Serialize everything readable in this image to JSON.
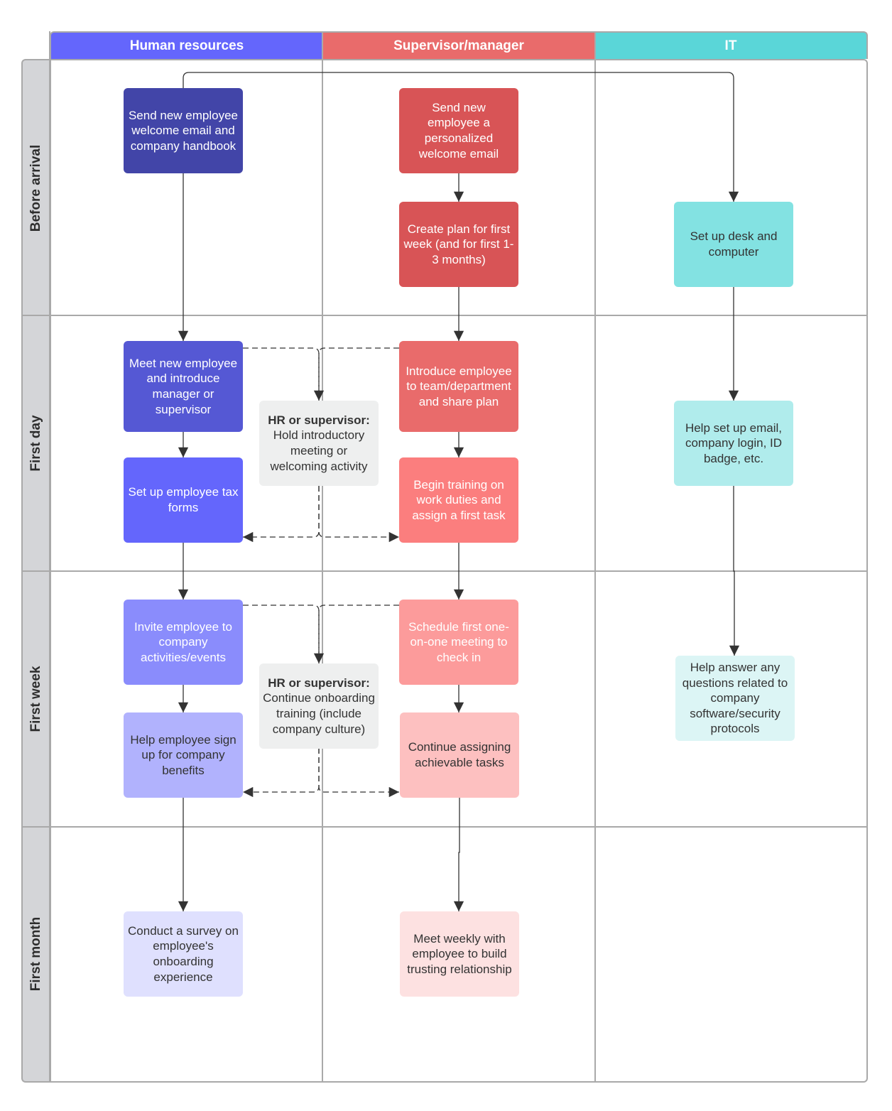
{
  "lanes": [
    {
      "label": "Human resources",
      "color": "#6466fc"
    },
    {
      "label": "Supervisor/manager",
      "color": "#e96b6b"
    },
    {
      "label": "IT",
      "color": "#5ad6d8"
    }
  ],
  "phases": [
    {
      "label": "Before arrival"
    },
    {
      "label": "First day"
    },
    {
      "label": "First week"
    },
    {
      "label": "First month"
    }
  ],
  "nodes": {
    "hr_welcome_email": {
      "text": "Send new employee welcome email and company handbook",
      "fill": "#4245a8",
      "text_color": "#ffffff"
    },
    "hr_meet_introduce": {
      "text": "Meet new employee and introduce manager or supervisor",
      "fill": "#5558d4",
      "text_color": "#ffffff"
    },
    "hr_tax_forms": {
      "text": "Set up employee tax forms",
      "fill": "#6466fc",
      "text_color": "#ffffff"
    },
    "hr_invite_events": {
      "text": "Invite employee to company activities/events",
      "fill": "#8a8cfc",
      "text_color": "#ffffff"
    },
    "hr_benefits": {
      "text": "Help employee sign up for company benefits",
      "fill": "#b1b2fd",
      "text_color": "#333333"
    },
    "hr_survey": {
      "text": "Conduct a survey on employee's onboarding experience",
      "fill": "#dfe0fe",
      "text_color": "#333333"
    },
    "shared_intro_meeting": {
      "bold": "HR or supervisor:",
      "text": "Hold introductory meeting or welcoming activity",
      "fill": "#eeefef",
      "text_color": "#333333"
    },
    "shared_onboarding_training": {
      "bold": "HR or supervisor:",
      "text": "Continue onboarding training (include company culture)",
      "fill": "#eeefef",
      "text_color": "#333333"
    },
    "mgr_personal_email": {
      "text": "Send new employee a personalized welcome email",
      "fill": "#d85456",
      "text_color": "#ffffff"
    },
    "mgr_create_plan": {
      "text": "Create plan for first week (and for first 1-3 months)",
      "fill": "#d85456",
      "text_color": "#ffffff"
    },
    "mgr_introduce_team": {
      "text": "Introduce employee to team/department and share plan",
      "fill": "#e96b6b",
      "text_color": "#ffffff"
    },
    "mgr_begin_training": {
      "text": "Begin training on work duties and assign a first task",
      "fill": "#fb7e7e",
      "text_color": "#ffffff"
    },
    "mgr_schedule_1on1": {
      "text": "Schedule first one-on-one meeting to check in",
      "fill": "#fc9b9b",
      "text_color": "#ffffff"
    },
    "mgr_continue_tasks": {
      "text": "Continue assigning achievable tasks",
      "fill": "#fdc0c0",
      "text_color": "#333333"
    },
    "mgr_meet_weekly": {
      "text": "Meet weekly with employee to build trusting relationship",
      "fill": "#fde1e1",
      "text_color": "#333333"
    },
    "it_desk_computer": {
      "text": "Set up desk and computer",
      "fill": "#83e2e2",
      "text_color": "#333333"
    },
    "it_email_login": {
      "text": "Help set up email, company login, ID badge, etc.",
      "fill": "#b0ecec",
      "text_color": "#333333"
    },
    "it_answer_questions": {
      "text": "Help answer any questions related to company software/security protocols",
      "fill": "#dcf5f5",
      "text_color": "#333333"
    }
  },
  "connectors": [
    {
      "from": "hr_welcome_email",
      "to": "hr_meet_introduce",
      "style": "solid"
    },
    {
      "from": "hr_welcome_email",
      "to": "it_desk_computer",
      "style": "solid"
    },
    {
      "from": "mgr_personal_email",
      "to": "mgr_create_plan",
      "style": "solid"
    },
    {
      "from": "mgr_create_plan",
      "to": "mgr_introduce_team",
      "style": "solid"
    },
    {
      "from": "it_desk_computer",
      "to": "it_email_login",
      "style": "solid"
    },
    {
      "from": "hr_meet_introduce",
      "to": "hr_tax_forms",
      "style": "solid"
    },
    {
      "from": "mgr_introduce_team",
      "to": "mgr_begin_training",
      "style": "solid"
    },
    {
      "from": "hr_meet_introduce",
      "to": "shared_intro_meeting",
      "style": "dashed"
    },
    {
      "from": "mgr_introduce_team",
      "to": "shared_intro_meeting",
      "style": "dashed"
    },
    {
      "from": "shared_intro_meeting",
      "to": "hr_tax_forms",
      "style": "dashed"
    },
    {
      "from": "shared_intro_meeting",
      "to": "mgr_begin_training",
      "style": "dashed"
    },
    {
      "from": "hr_tax_forms",
      "to": "hr_invite_events",
      "style": "solid"
    },
    {
      "from": "mgr_begin_training",
      "to": "mgr_schedule_1on1",
      "style": "solid"
    },
    {
      "from": "it_email_login",
      "to": "it_answer_questions",
      "style": "solid"
    },
    {
      "from": "hr_invite_events",
      "to": "hr_benefits",
      "style": "solid"
    },
    {
      "from": "mgr_schedule_1on1",
      "to": "mgr_continue_tasks",
      "style": "solid"
    },
    {
      "from": "hr_invite_events",
      "to": "shared_onboarding_training",
      "style": "dashed"
    },
    {
      "from": "mgr_schedule_1on1",
      "to": "shared_onboarding_training",
      "style": "dashed"
    },
    {
      "from": "shared_onboarding_training",
      "to": "hr_benefits",
      "style": "dashed"
    },
    {
      "from": "shared_onboarding_training",
      "to": "mgr_continue_tasks",
      "style": "dashed"
    },
    {
      "from": "hr_benefits",
      "to": "hr_survey",
      "style": "solid"
    },
    {
      "from": "mgr_continue_tasks",
      "to": "mgr_meet_weekly",
      "style": "solid"
    }
  ]
}
